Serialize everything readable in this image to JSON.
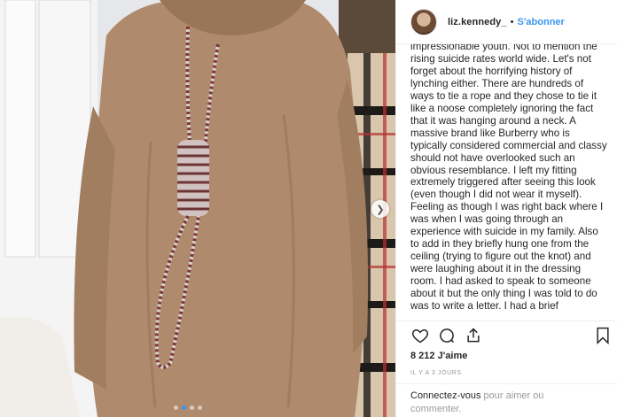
{
  "post": {
    "username": "liz.kennedy_",
    "separator": "•",
    "follow_label": "S'abonner",
    "caption": "impressionable youth. Not to mention the\nrising suicide rates world wide. Let's not\nforget about the horrifying history of\nlynching either. There are hundreds of\nways to tie a rope and they chose to tie it\nlike a noose completely ignoring the fact\nthat it was hanging around a neck. A\nmassive brand like Burberry who is\ntypically considered commercial and classy\nshould not have overlooked such an\nobvious resemblance. I left my fitting\nextremely triggered after seeing this look\n(even though I did not wear it myself).\nFeeling as though I was right back where I\nwas when I was going through an\nexperience with suicide in my family. Also\nto add in they briefly hung one from the\nceiling (trying to figure out the knot) and\nwere laughing about it in the dressing\nroom. I had asked to speak to someone\nabout it but the only thing I was told to do\nwas to write a letter. I had a brief",
    "likes": "8 212 J'aime",
    "time": "Il y a 3 jours",
    "login_link": "Connectez-vous",
    "login_rest": " pour aimer ou commenter."
  },
  "icons": {
    "like": "heart-icon",
    "comment": "comment-icon",
    "share": "share-icon",
    "save": "bookmark-icon",
    "next": "chevron-right-icon"
  },
  "carousel": {
    "count": 4,
    "active_index": 1
  },
  "colors": {
    "accent": "#3897f0",
    "text": "#262626",
    "muted": "#999999",
    "border": "#efefef"
  }
}
